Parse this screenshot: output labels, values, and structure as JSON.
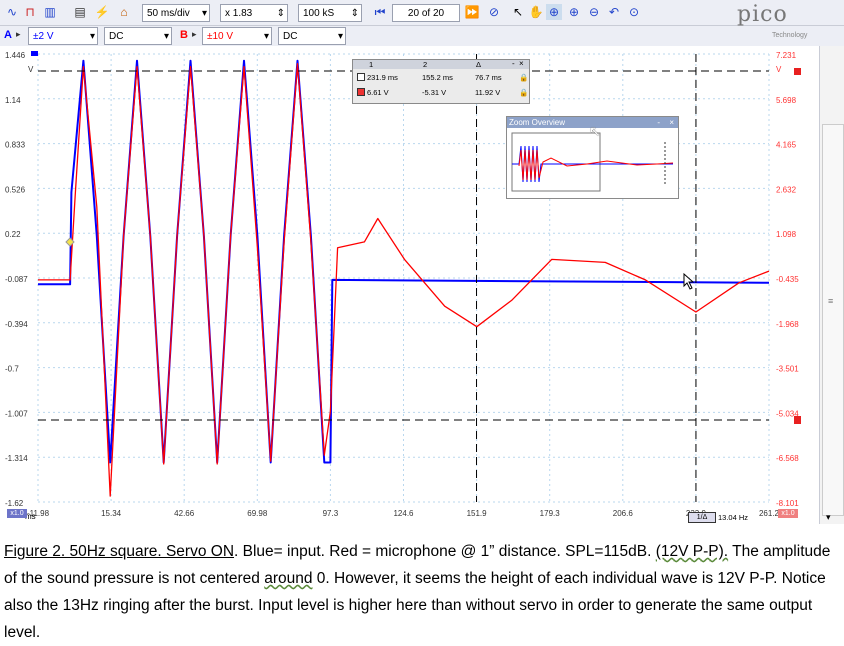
{
  "toolbar": {
    "timebase": "50 ms/div",
    "zoom": "x 1.83",
    "samples": "100 kS",
    "capture_index": "20  of 20",
    "brand": "pico",
    "brand_sub": "Technology"
  },
  "channel_a": {
    "label": "A",
    "range": "±2 V",
    "coupling": "DC",
    "color": "#0000ff"
  },
  "channel_b": {
    "label": "B",
    "range": "±10 V",
    "coupling": "DC",
    "color": "#ff0000"
  },
  "axes": {
    "left_ticks": [
      "1.446",
      "1.14",
      "0.833",
      "0.526",
      "0.22",
      "-0.087",
      "-0.394",
      "-0.7",
      "-1.007",
      "-1.314",
      "-1.62"
    ],
    "left_unit": "V",
    "right_ticks": [
      "7.231",
      "5.698",
      "4.165",
      "2.632",
      "1.098",
      "-0.435",
      "-1.968",
      "-3.501",
      "-5.034",
      "-6.568",
      "-8.101"
    ],
    "right_unit": "V",
    "bottom_ticks": [
      "-11.98",
      "15.34",
      "42.66",
      "69.98",
      "97.3",
      "124.6",
      "151.9",
      "179.3",
      "206.6",
      "233.9",
      "261.2"
    ],
    "bottom_unit": "ms",
    "x_zoom_badge": "x1.0",
    "x_zoom_badge_right": "x1.0",
    "freq_readout": "13.04 Hz",
    "freq_mode": "1/Δ"
  },
  "rulers": {
    "col1": "1",
    "col2": "2",
    "col3": "Δ",
    "row1": [
      "231.9 ms",
      "155.2 ms",
      "76.7 ms"
    ],
    "row2": [
      "6.61 V",
      "-5.31 V",
      "11.92 V"
    ]
  },
  "zoom_overview": {
    "title": "Zoom Overview"
  },
  "chart_data": {
    "type": "line",
    "xlabel": "ms",
    "xlim": [
      -11.98,
      261.2
    ],
    "ylim_left": [
      -1.62,
      1.446
    ],
    "ylim_right": [
      -8.101,
      7.231
    ],
    "series": [
      {
        "name": "A",
        "color": "#0000ff",
        "x": [
          -11.98,
          0,
          0.5,
          5,
          10,
          15,
          20,
          25,
          30,
          35,
          40,
          45,
          50,
          55,
          60,
          65,
          70,
          75,
          80,
          85,
          90,
          95,
          97.3,
          98,
          261.2
        ],
        "y": [
          -0.13,
          -0.13,
          0.5,
          1.4,
          0.2,
          -1.35,
          0.2,
          1.4,
          0.2,
          -1.35,
          0.2,
          1.4,
          0.2,
          -1.35,
          0.2,
          1.4,
          0.2,
          -1.35,
          0.2,
          1.4,
          0.2,
          -1.35,
          -1.35,
          -0.1,
          -0.12
        ]
      },
      {
        "name": "B",
        "color": "#ff0000",
        "x": [
          -11.98,
          0,
          2,
          5,
          10,
          15,
          20,
          25,
          30,
          35,
          40,
          45,
          50,
          55,
          60,
          65,
          70,
          75,
          80,
          85,
          90,
          95,
          97.3,
          100,
          110,
          115,
          125,
          140,
          152,
          165,
          180,
          200,
          215,
          233.9,
          250,
          261.2
        ],
        "y": [
          -0.5,
          -0.5,
          2.5,
          6.8,
          2.0,
          -7.9,
          1.0,
          6.8,
          1.0,
          -6.8,
          1.0,
          6.8,
          1.0,
          -6.8,
          1.0,
          6.8,
          0.6,
          -6.7,
          0.8,
          6.9,
          0.8,
          -6.5,
          -5.0,
          0.6,
          0.8,
          1.6,
          0.2,
          -1.4,
          -2.1,
          -1.2,
          0.2,
          0.1,
          -0.5,
          -1.6,
          -0.6,
          -0.2
        ]
      }
    ]
  },
  "caption": {
    "p1": "Figure 2. 50Hz square. Servo ON",
    "p2": ". Blue= input. Red = microphone @ 1” distance.   SPL=115dB. ",
    "p3": "(12V P-P).",
    "p4": "  The amplitude of the sound pressure is not centered ",
    "p5": "around",
    "p6": " 0. However, it seems the height of each individual wave is 12V P-P. Notice also the 13Hz ringing after the burst. Input level is higher here than without servo in order to generate the same output level."
  }
}
